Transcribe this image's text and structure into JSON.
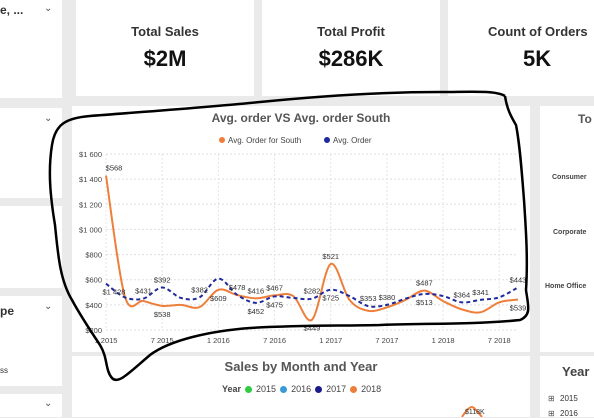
{
  "slicer_top_fragment": "e, ...",
  "slicer_mid_fragment": "pe",
  "slicer_low_fragment": "ss",
  "kpis": [
    {
      "title": "Total Sales",
      "value": "$2M"
    },
    {
      "title": "Total Profit",
      "value": "$286K"
    },
    {
      "title": "Count of Orders",
      "value": "5K"
    }
  ],
  "right_panel": {
    "title_fragment": "To",
    "labels": [
      "Consumer",
      "Corporate",
      "Home Office"
    ],
    "year_fragment": "Year",
    "year_items": [
      "2015",
      "2016"
    ]
  },
  "bottom_chart": {
    "title": "Sales by Month and Year",
    "legend_label": "Year",
    "legend": [
      {
        "name": "2015",
        "color": "#2ecc40"
      },
      {
        "name": "2016",
        "color": "#3a9ad9"
      },
      {
        "name": "2017",
        "color": "#1a1a8c"
      },
      {
        "name": "2018",
        "color": "#ee7f3b"
      }
    ],
    "peek_label": "$118K"
  },
  "colors": {
    "south": "#ee7f3b",
    "avg": "#1f2a9c"
  },
  "chart_data": {
    "type": "line",
    "title": "Avg. order VS Avg. order South",
    "series": [
      {
        "name": "Avg. Order for South",
        "color": "#ee7f3b",
        "style": "solid",
        "values": [
          1428,
          470,
          431,
          392,
          400,
          382,
          520,
          478,
          452,
          475,
          470,
          282,
          725,
          440,
          353,
          380,
          440,
          513,
          430,
          364,
          341,
          420,
          443
        ]
      },
      {
        "name": "Avg. Order",
        "color": "#1f2a9c",
        "style": "dashed",
        "values": [
          568,
          460,
          450,
          538,
          455,
          460,
          609,
          480,
          416,
          467,
          455,
          449,
          521,
          470,
          390,
          400,
          450,
          487,
          470,
          420,
          440,
          460,
          539
        ]
      }
    ],
    "x": [
      0,
      1,
      2,
      3,
      4,
      5,
      6,
      7,
      8,
      9,
      10,
      11,
      12,
      13,
      14,
      15,
      16,
      17,
      18,
      19,
      20,
      21,
      22
    ],
    "x_ticks": [
      "1 2015",
      "7 2015",
      "1 2016",
      "7 2016",
      "1 2017",
      "7 2017",
      "1 2018",
      "7 2018"
    ],
    "y_ticks": [
      "$1 600",
      "$1 400",
      "$1 200",
      "$1 000",
      "$800",
      "$600",
      "$400",
      "$200"
    ],
    "ylim": [
      200,
      1600
    ],
    "labels": [
      {
        "i": 0,
        "s": 1,
        "t": "$1 428"
      },
      {
        "i": 0,
        "s": 0,
        "t": "$568"
      },
      {
        "i": 2,
        "s": 1,
        "t": "$431"
      },
      {
        "i": 3,
        "s": 0,
        "t": "$538"
      },
      {
        "i": 3,
        "s": 1,
        "t": "$392"
      },
      {
        "i": 5,
        "s": 1,
        "t": "$382"
      },
      {
        "i": 6,
        "s": 0,
        "t": "$609"
      },
      {
        "i": 7,
        "s": 1,
        "t": "$478"
      },
      {
        "i": 8,
        "s": 0,
        "t": "$416"
      },
      {
        "i": 8,
        "s": 1,
        "t": "$452"
      },
      {
        "i": 9,
        "s": 0,
        "t": "$467"
      },
      {
        "i": 9,
        "s": 1,
        "t": "$475"
      },
      {
        "i": 11,
        "s": 0,
        "t": "$449"
      },
      {
        "i": 11,
        "s": 1,
        "t": "$282"
      },
      {
        "i": 12,
        "s": 1,
        "t": "$725"
      },
      {
        "i": 12,
        "s": 0,
        "t": "$521"
      },
      {
        "i": 14,
        "s": 1,
        "t": "$353"
      },
      {
        "i": 15,
        "s": 1,
        "t": "$380"
      },
      {
        "i": 17,
        "s": 0,
        "t": "$487"
      },
      {
        "i": 17,
        "s": 1,
        "t": "$513"
      },
      {
        "i": 19,
        "s": 1,
        "t": "$364"
      },
      {
        "i": 20,
        "s": 1,
        "t": "$341"
      },
      {
        "i": 22,
        "s": 0,
        "t": "$539"
      },
      {
        "i": 22,
        "s": 1,
        "t": "$443"
      }
    ],
    "grid": true,
    "legend_position": "top-center"
  }
}
